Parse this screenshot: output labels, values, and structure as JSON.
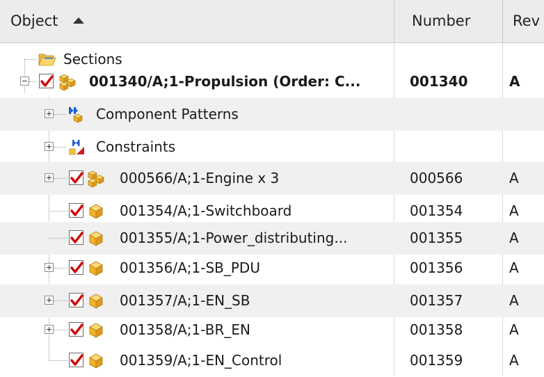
{
  "columns": {
    "object": "Object",
    "number": "Number",
    "rev": "Rev"
  },
  "icons": {
    "folder": "folder-open-icon",
    "assembly": "assembly-icon",
    "part": "part-cube-icon",
    "patterns": "component-patterns-icon",
    "constraints": "constraints-icon",
    "checkbox": "checkbox-checked-icon"
  },
  "colors": {
    "check": "#d20000",
    "cube": "#f2b32a",
    "header_bg": "#ececec",
    "row_shade": "#f0f0f0"
  },
  "rows": [
    {
      "name": "Sections",
      "number": "",
      "rev": ""
    },
    {
      "name": "001340/A;1-Propulsion (Order: C...",
      "number": "001340",
      "rev": "A"
    },
    {
      "name": "Component Patterns",
      "number": "",
      "rev": ""
    },
    {
      "name": "Constraints",
      "number": "",
      "rev": ""
    },
    {
      "name": "000566/A;1-Engine x 3",
      "number": "000566",
      "rev": "A"
    },
    {
      "name": "001354/A;1-Switchboard",
      "number": "001354",
      "rev": "A"
    },
    {
      "name": "001355/A;1-Power_distributing...",
      "number": "001355",
      "rev": "A"
    },
    {
      "name": "001356/A;1-SB_PDU",
      "number": "001356",
      "rev": "A"
    },
    {
      "name": "001357/A;1-EN_SB",
      "number": "001357",
      "rev": "A"
    },
    {
      "name": "001358/A;1-BR_EN",
      "number": "001358",
      "rev": "A"
    },
    {
      "name": "001359/A;1-EN_Control",
      "number": "001359",
      "rev": "A"
    }
  ]
}
